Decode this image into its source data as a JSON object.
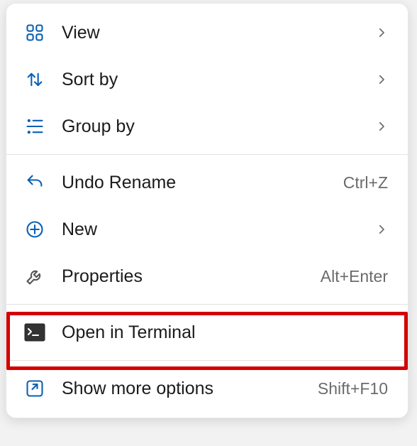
{
  "menu": {
    "items": [
      {
        "label": "View",
        "has_submenu": true
      },
      {
        "label": "Sort by",
        "has_submenu": true
      },
      {
        "label": "Group by",
        "has_submenu": true
      },
      {
        "label": "Undo Rename",
        "shortcut": "Ctrl+Z"
      },
      {
        "label": "New",
        "has_submenu": true
      },
      {
        "label": "Properties",
        "shortcut": "Alt+Enter"
      },
      {
        "label": "Open in Terminal"
      },
      {
        "label": "Show more options",
        "shortcut": "Shift+F10"
      }
    ]
  },
  "highlight": {
    "item_index": 6
  }
}
